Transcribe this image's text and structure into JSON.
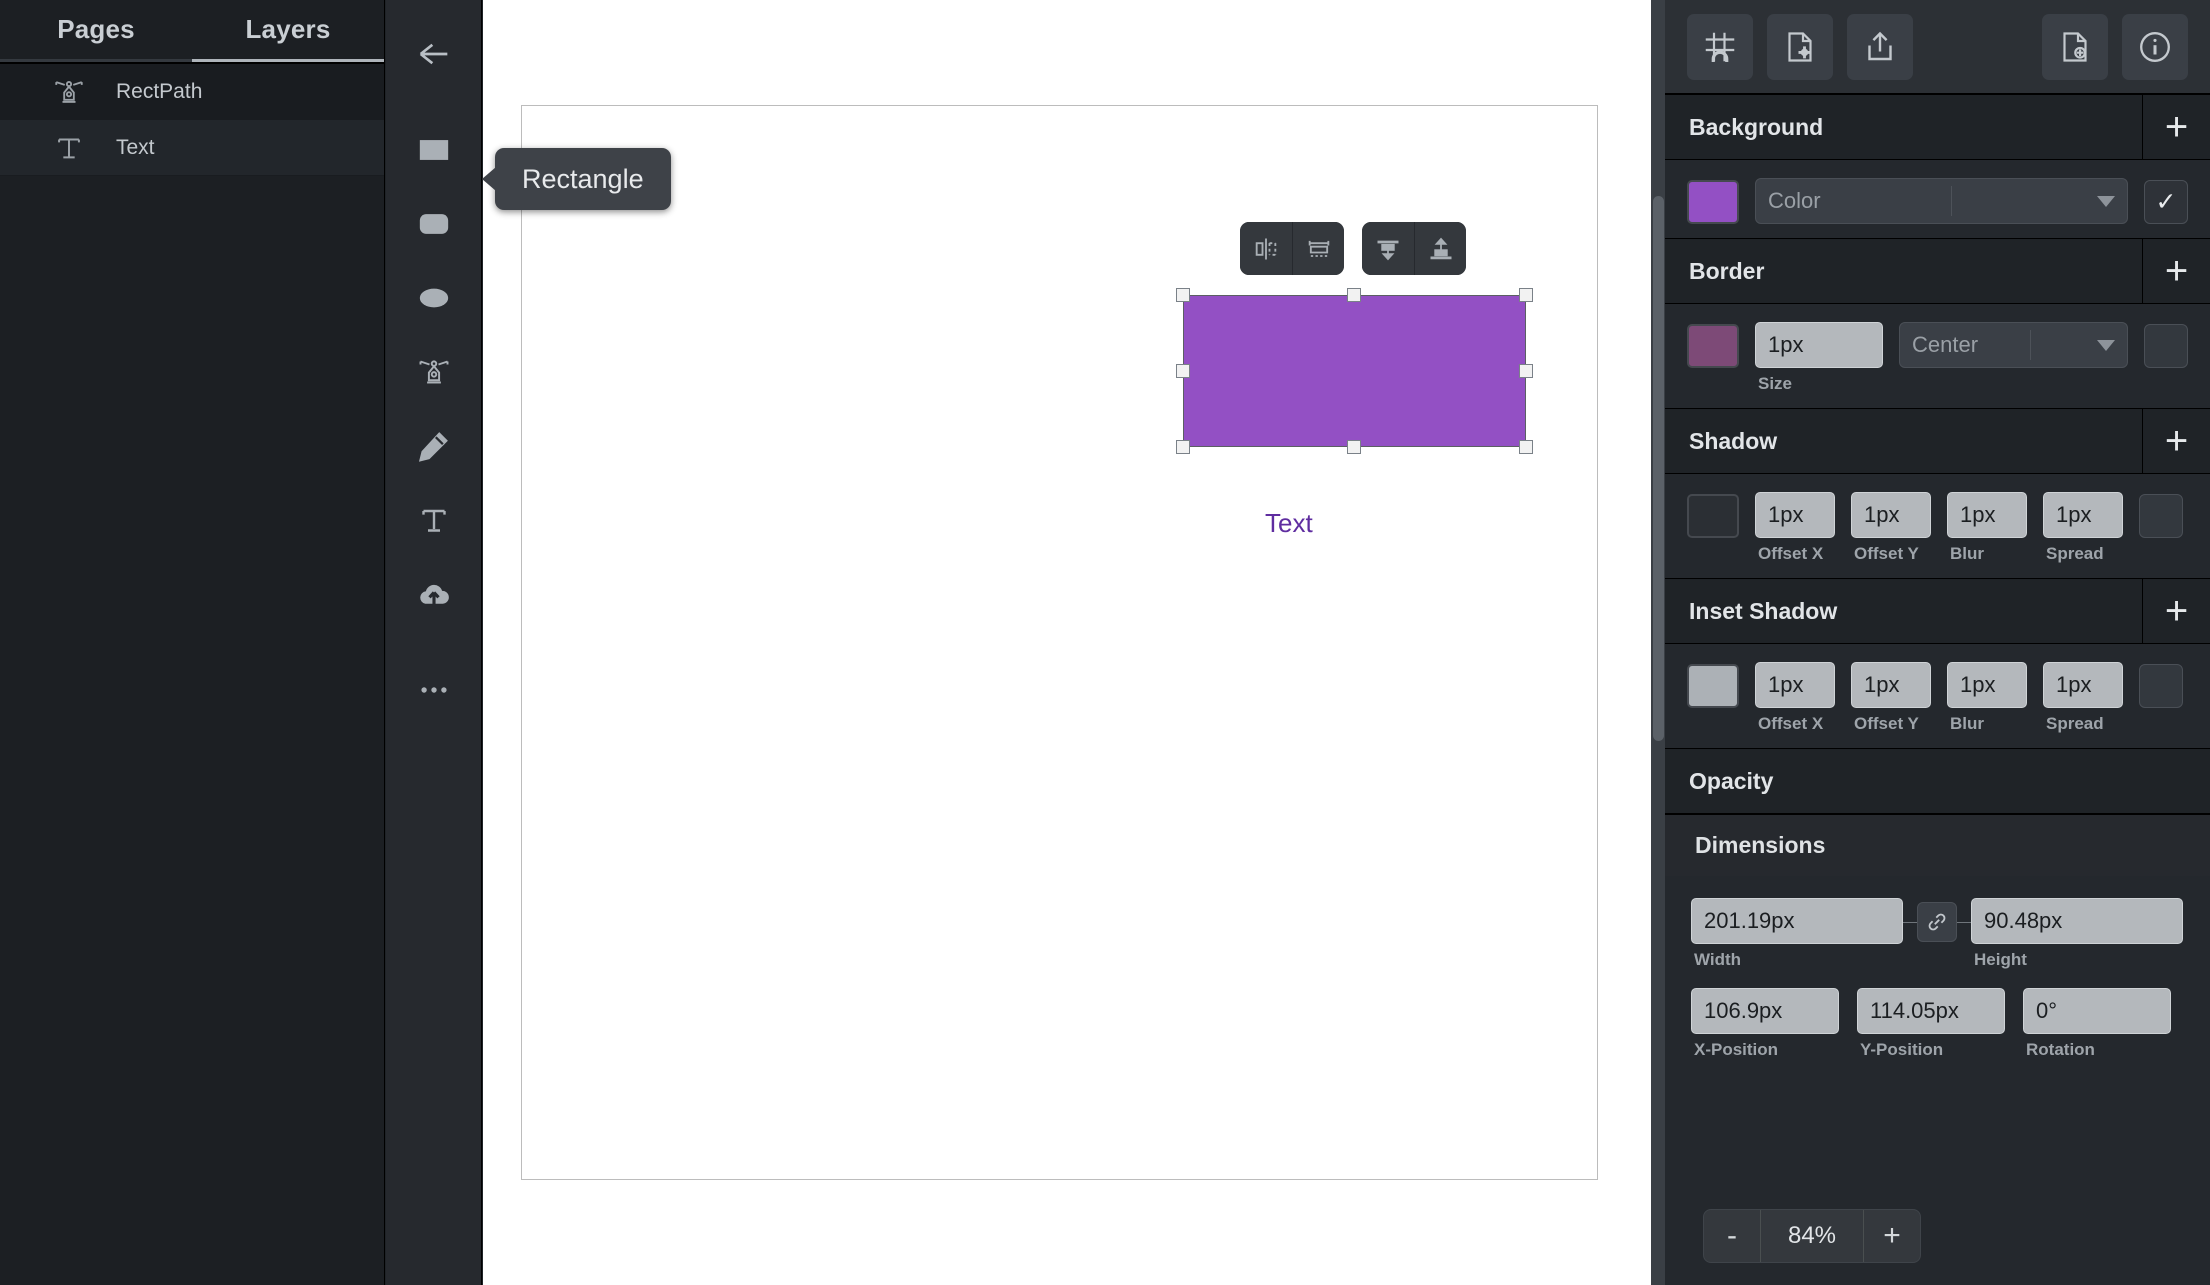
{
  "left_panel": {
    "tabs": [
      {
        "label": "Pages",
        "active": false
      },
      {
        "label": "Layers",
        "active": true
      }
    ],
    "layers": [
      {
        "name": "RectPath",
        "icon": "pen-path-icon",
        "selected": true
      },
      {
        "name": "Text",
        "icon": "text-icon",
        "selected": false
      }
    ]
  },
  "toolbar": {
    "tools": [
      {
        "icon": "back-arrow-icon",
        "name": "back"
      },
      {
        "icon": "rectangle-icon",
        "name": "rectangle"
      },
      {
        "icon": "rounded-rectangle-icon",
        "name": "rounded-rectangle"
      },
      {
        "icon": "ellipse-icon",
        "name": "ellipse"
      },
      {
        "icon": "pen-path-icon",
        "name": "pen"
      },
      {
        "icon": "pencil-icon",
        "name": "pencil"
      },
      {
        "icon": "text-icon",
        "name": "text"
      },
      {
        "icon": "cloud-upload-icon",
        "name": "upload"
      },
      {
        "icon": "more-icon",
        "name": "more"
      }
    ],
    "tooltip": "Rectangle"
  },
  "canvas": {
    "align_buttons": [
      {
        "icon": "align-horizontal-center-icon",
        "name": "align-horizontal-center"
      },
      {
        "icon": "distribute-horizontal-icon",
        "name": "distribute-horizontal"
      },
      {
        "icon": "align-vertical-bottom-icon",
        "name": "align-vertical-bottom"
      },
      {
        "icon": "align-vertical-top-icon",
        "name": "align-vertical-top"
      }
    ],
    "shape_fill": "#9350c4",
    "text_label": "Text",
    "text_color": "#5f2da0"
  },
  "right_panel": {
    "top_icons": [
      {
        "name": "snap-to-grid-icon"
      },
      {
        "name": "document-settings-icon"
      },
      {
        "name": "export-icon"
      },
      {
        "name": "new-document-icon"
      },
      {
        "name": "info-icon"
      }
    ],
    "background": {
      "title": "Background",
      "add_label": "+",
      "swatch_color": "#9350c4",
      "type_value": "Color",
      "enabled": true
    },
    "border": {
      "title": "Border",
      "add_label": "+",
      "swatch_color": "#7d4a77",
      "size_value": "1px",
      "size_label": "Size",
      "position_value": "Center",
      "enabled": false
    },
    "shadow": {
      "title": "Shadow",
      "add_label": "+",
      "swatch_color": "#2b2f34",
      "fields": [
        {
          "value": "1px",
          "label": "Offset X"
        },
        {
          "value": "1px",
          "label": "Offset Y"
        },
        {
          "value": "1px",
          "label": "Blur"
        },
        {
          "value": "1px",
          "label": "Spread"
        }
      ],
      "enabled": false
    },
    "inset_shadow": {
      "title": "Inset Shadow",
      "add_label": "+",
      "swatch_color": "#acb1b6",
      "fields": [
        {
          "value": "1px",
          "label": "Offset X"
        },
        {
          "value": "1px",
          "label": "Offset Y"
        },
        {
          "value": "1px",
          "label": "Blur"
        },
        {
          "value": "1px",
          "label": "Spread"
        }
      ],
      "enabled": false
    },
    "opacity": {
      "title": "Opacity"
    },
    "dimensions": {
      "title": "Dimensions",
      "width": {
        "value": "201.19px",
        "label": "Width"
      },
      "height": {
        "value": "90.48px",
        "label": "Height"
      },
      "x_position": {
        "value": "106.9px",
        "label": "X-Position"
      },
      "y_position": {
        "value": "114.05px",
        "label": "Y-Position"
      },
      "rotation": {
        "value": "0°",
        "label": "Rotation"
      }
    },
    "zoom": {
      "minus": "-",
      "value": "84%",
      "plus": "+"
    }
  }
}
